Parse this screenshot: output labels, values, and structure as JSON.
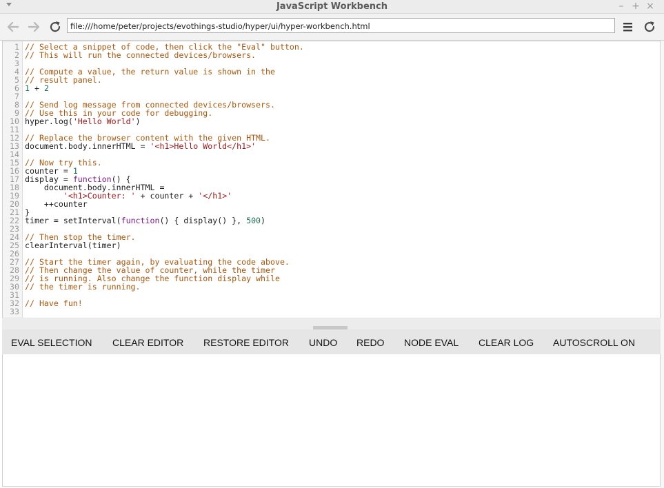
{
  "window": {
    "title": "JavaScript Workbench",
    "minimize_label": "–",
    "maximize_label": "+",
    "close_label": "×"
  },
  "toolbar": {
    "url": "file:///home/peter/projects/evothings-studio/hyper/ui/hyper-workbench.html"
  },
  "editor": {
    "lines": [
      {
        "n": "1",
        "tokens": [
          {
            "t": "// Select a snippet of code, then click the \"Eval\" button.",
            "c": "comment"
          }
        ]
      },
      {
        "n": "2",
        "tokens": [
          {
            "t": "// This will run the connected devices/browsers.",
            "c": "comment"
          }
        ]
      },
      {
        "n": "3",
        "tokens": []
      },
      {
        "n": "4",
        "tokens": [
          {
            "t": "// Compute a value, the return value is shown in the",
            "c": "comment"
          }
        ]
      },
      {
        "n": "5",
        "tokens": [
          {
            "t": "// result panel.",
            "c": "comment"
          }
        ]
      },
      {
        "n": "6",
        "tokens": [
          {
            "t": "1",
            "c": "num"
          },
          {
            "t": " + ",
            "c": "plain"
          },
          {
            "t": "2",
            "c": "num"
          }
        ]
      },
      {
        "n": "7",
        "tokens": []
      },
      {
        "n": "8",
        "tokens": [
          {
            "t": "// Send log message from connected devices/browsers.",
            "c": "comment"
          }
        ]
      },
      {
        "n": "9",
        "tokens": [
          {
            "t": "// Use this in your code for debugging.",
            "c": "comment"
          }
        ]
      },
      {
        "n": "10",
        "tokens": [
          {
            "t": "hyper.log(",
            "c": "plain"
          },
          {
            "t": "'Hello World'",
            "c": "str"
          },
          {
            "t": ")",
            "c": "plain"
          }
        ]
      },
      {
        "n": "11",
        "tokens": []
      },
      {
        "n": "12",
        "tokens": [
          {
            "t": "// Replace the browser content with the given HTML.",
            "c": "comment"
          }
        ]
      },
      {
        "n": "13",
        "tokens": [
          {
            "t": "document.body.innerHTML = ",
            "c": "plain"
          },
          {
            "t": "'<h1>Hello World</h1>'",
            "c": "str"
          }
        ]
      },
      {
        "n": "14",
        "tokens": []
      },
      {
        "n": "15",
        "tokens": [
          {
            "t": "// Now try this.",
            "c": "comment"
          }
        ]
      },
      {
        "n": "16",
        "tokens": [
          {
            "t": "counter = ",
            "c": "plain"
          },
          {
            "t": "1",
            "c": "num"
          }
        ]
      },
      {
        "n": "17",
        "tokens": [
          {
            "t": "display = ",
            "c": "plain"
          },
          {
            "t": "function",
            "c": "kw"
          },
          {
            "t": "() {",
            "c": "plain"
          }
        ]
      },
      {
        "n": "18",
        "tokens": [
          {
            "t": "    document.body.innerHTML =",
            "c": "plain"
          }
        ]
      },
      {
        "n": "19",
        "tokens": [
          {
            "t": "        ",
            "c": "plain"
          },
          {
            "t": "'<h1>Counter: '",
            "c": "str"
          },
          {
            "t": " + counter + ",
            "c": "plain"
          },
          {
            "t": "'</h1>'",
            "c": "str"
          }
        ]
      },
      {
        "n": "20",
        "tokens": [
          {
            "t": "    ++counter",
            "c": "plain"
          }
        ]
      },
      {
        "n": "21",
        "tokens": [
          {
            "t": "}",
            "c": "plain"
          }
        ]
      },
      {
        "n": "22",
        "tokens": [
          {
            "t": "timer = setInterval(",
            "c": "plain"
          },
          {
            "t": "function",
            "c": "kw"
          },
          {
            "t": "() { display() }, ",
            "c": "plain"
          },
          {
            "t": "500",
            "c": "num"
          },
          {
            "t": ")",
            "c": "plain"
          }
        ]
      },
      {
        "n": "23",
        "tokens": []
      },
      {
        "n": "24",
        "tokens": [
          {
            "t": "// Then stop the timer.",
            "c": "comment"
          }
        ]
      },
      {
        "n": "25",
        "tokens": [
          {
            "t": "clearInterval(timer)",
            "c": "plain"
          }
        ]
      },
      {
        "n": "26",
        "tokens": []
      },
      {
        "n": "27",
        "tokens": [
          {
            "t": "// Start the timer again, by evaluating the code above.",
            "c": "comment"
          }
        ]
      },
      {
        "n": "28",
        "tokens": [
          {
            "t": "// Then change the value of counter, while the timer",
            "c": "comment"
          }
        ]
      },
      {
        "n": "29",
        "tokens": [
          {
            "t": "// is running. Also change the function display while",
            "c": "comment"
          }
        ]
      },
      {
        "n": "30",
        "tokens": [
          {
            "t": "// the timer is running.",
            "c": "comment"
          }
        ]
      },
      {
        "n": "31",
        "tokens": []
      },
      {
        "n": "32",
        "tokens": [
          {
            "t": "// Have fun!",
            "c": "comment"
          }
        ]
      },
      {
        "n": "33",
        "tokens": []
      }
    ]
  },
  "buttons": {
    "eval_selection": "EVAL SELECTION",
    "clear_editor": "CLEAR EDITOR",
    "restore_editor": "RESTORE EDITOR",
    "undo": "UNDO",
    "redo": "REDO",
    "node_eval": "NODE EVAL",
    "clear_log": "CLEAR LOG",
    "autoscroll": "AUTOSCROLL ON"
  },
  "icons": {
    "back": "arrow-left-icon",
    "forward": "arrow-right-icon",
    "reload": "reload-icon",
    "menu": "hamburger-menu-icon",
    "reload_right": "reload-icon"
  },
  "colors": {
    "comment": "#a9570d",
    "string": "#a11717",
    "number": "#1d6e4d",
    "keyword": "#7a1d8c"
  }
}
